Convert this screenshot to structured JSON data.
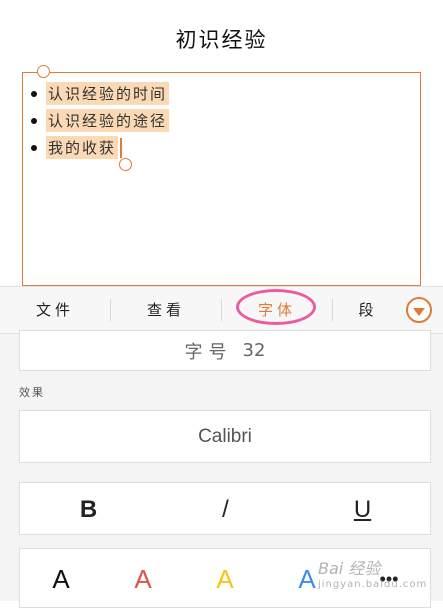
{
  "document": {
    "title": "初识经验",
    "bullets": [
      "认识经验的时间",
      "认识经验的途径",
      "我的收获"
    ]
  },
  "tabs": [
    {
      "label": "文件",
      "active": false
    },
    {
      "label": "查看",
      "active": false
    },
    {
      "label": "字体",
      "active": true
    },
    {
      "label": "段",
      "active": false
    }
  ],
  "more_icon": "chevron-down-circle-icon",
  "panel": {
    "font_size_label": "字号",
    "font_size_value": "32",
    "effects_label": "效果",
    "font_name": "Calibri",
    "styles": {
      "bold": "B",
      "italic": "/",
      "underline": "U"
    },
    "colors": [
      {
        "label": "A",
        "color": "#111111"
      },
      {
        "label": "A",
        "color": "#e0534b"
      },
      {
        "label": "A",
        "color": "#f5c518"
      },
      {
        "label": "A",
        "color": "#3b8fe8"
      }
    ],
    "colors_more": "•••"
  },
  "accent_color": "#e07b39",
  "highlight_color": "#fbd9b5",
  "watermark": {
    "text": "Bai 经验",
    "sub": "jingyan.baidu.com"
  }
}
